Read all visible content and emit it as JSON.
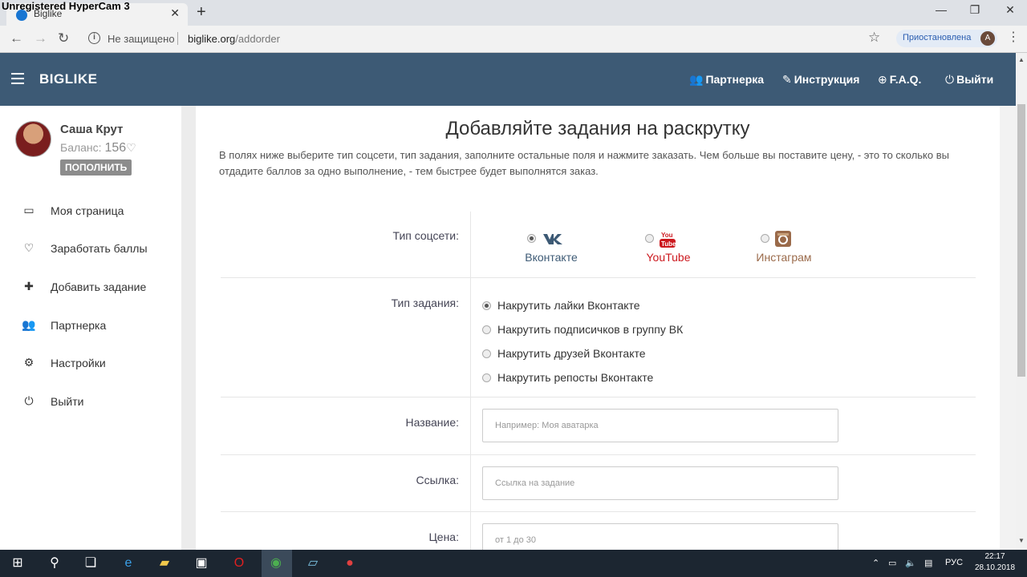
{
  "watermark": "Unregistered HyperCam 3",
  "browser": {
    "tab_title": "Biglike",
    "tab_close": "✕",
    "new_tab": "+",
    "window_controls": [
      "—",
      "❐",
      "✕"
    ],
    "insecure_label": "Не защищено",
    "url_host": "biglike.org",
    "url_path": "/addorder",
    "paused_label": "Приостановлена",
    "profile_initial": "A"
  },
  "header": {
    "brand": "BIGLIKE",
    "nav": [
      {
        "icon": "users-icon",
        "glyph": "👥",
        "label": "Партнерка"
      },
      {
        "icon": "pencil-icon",
        "glyph": "✎",
        "label": "Инструкция"
      },
      {
        "icon": "globe-icon",
        "glyph": "⊕",
        "label": "F.A.Q."
      },
      {
        "icon": "power-icon",
        "glyph": "⏻",
        "label": "Выйти"
      }
    ]
  },
  "user": {
    "name": "Саша Крут",
    "balance_label": "Баланс:",
    "balance_value": "156",
    "balance_icon": "♡",
    "topup_label": "ПОПОЛНИТЬ"
  },
  "sidebar": {
    "items": [
      {
        "icon": "laptop-icon",
        "glyph": "▭",
        "label": "Моя страница"
      },
      {
        "icon": "heart-icon",
        "glyph": "♡",
        "label": "Заработать баллы"
      },
      {
        "icon": "plus-icon",
        "glyph": "✚",
        "label": "Добавить задание"
      },
      {
        "icon": "users-icon",
        "glyph": "👥",
        "label": "Партнерка"
      },
      {
        "icon": "gears-icon",
        "glyph": "⚙",
        "label": "Настройки"
      },
      {
        "icon": "power-icon",
        "glyph": "⏻",
        "label": "Выйти"
      }
    ]
  },
  "main": {
    "title": "Добавляйте задания на раскрутку",
    "intro": "В полях ниже выберите тип соцсети, тип задания, заполните остальные поля и нажмите заказать. Чем больше вы поставите цену, - это то сколько вы отдадите баллов за одно выполнение, - тем быстрее будет выполнятся заказ.",
    "social_label": "Тип соцсети:",
    "socials": [
      {
        "label": "Вконтакте",
        "icon": "vk-icon",
        "color": "#3d5a75",
        "selected": true
      },
      {
        "label": "YouTube",
        "icon": "youtube-icon",
        "color": "#cc181e",
        "selected": false
      },
      {
        "label": "Инстаграм",
        "icon": "instagram-icon",
        "color": "#9a6a4a",
        "selected": false
      }
    ],
    "task_label": "Тип задания:",
    "tasks": [
      {
        "label": "Накрутить лайки Вконтакте",
        "selected": true
      },
      {
        "label": "Накрутить подписичков в группу ВК",
        "selected": false
      },
      {
        "label": "Накрутить друзей Вконтакте",
        "selected": false
      },
      {
        "label": "Накрутить репосты Вконтакте",
        "selected": false
      }
    ],
    "name_label": "Название:",
    "name_placeholder": "Например: Моя аватарка",
    "link_label": "Ссылка:",
    "link_placeholder": "Ссылка на задание",
    "price_label": "Цена:",
    "price_placeholder": "от 1 до 30"
  },
  "taskbar": {
    "lang": "РУС",
    "time": "22:17",
    "date": "28.10.2018"
  }
}
